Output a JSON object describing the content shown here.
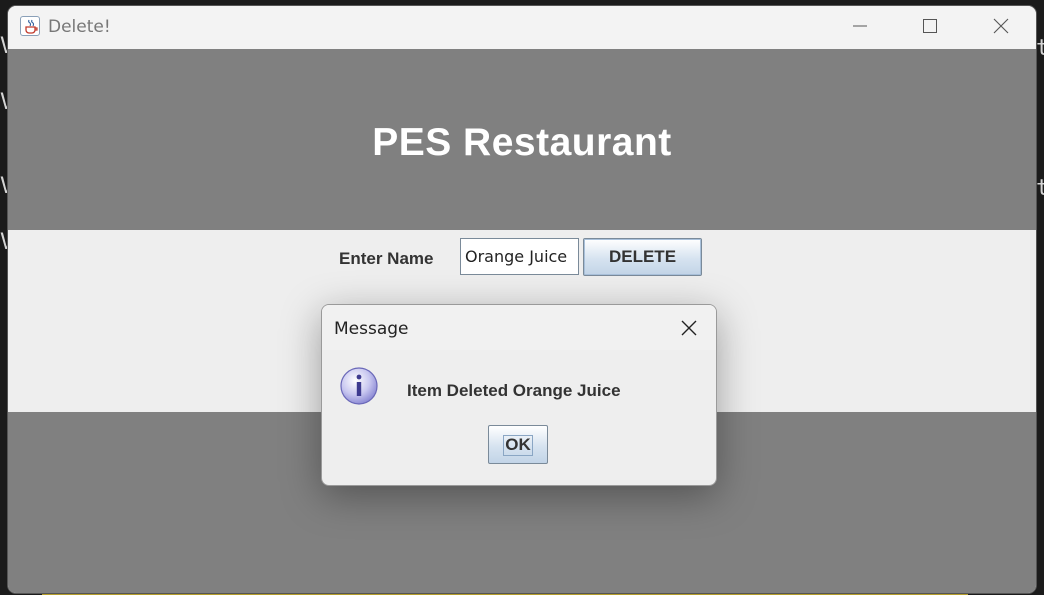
{
  "window": {
    "title": "Delete!",
    "controls": {
      "minimize": "minimize-icon",
      "maximize": "maximize-icon",
      "close": "close-icon"
    }
  },
  "header": {
    "title": "PES Restaurant",
    "background": "#808080"
  },
  "form": {
    "name_label": "Enter Name",
    "name_value": "Orange Juice",
    "delete_label": "DELETE"
  },
  "dialog": {
    "title": "Message",
    "message": "Item Deleted Orange Juice",
    "ok_label": "OK",
    "icon": "info-icon"
  },
  "background_text": [
    "V",
    "V",
    "V",
    "V",
    "t",
    "t"
  ]
}
